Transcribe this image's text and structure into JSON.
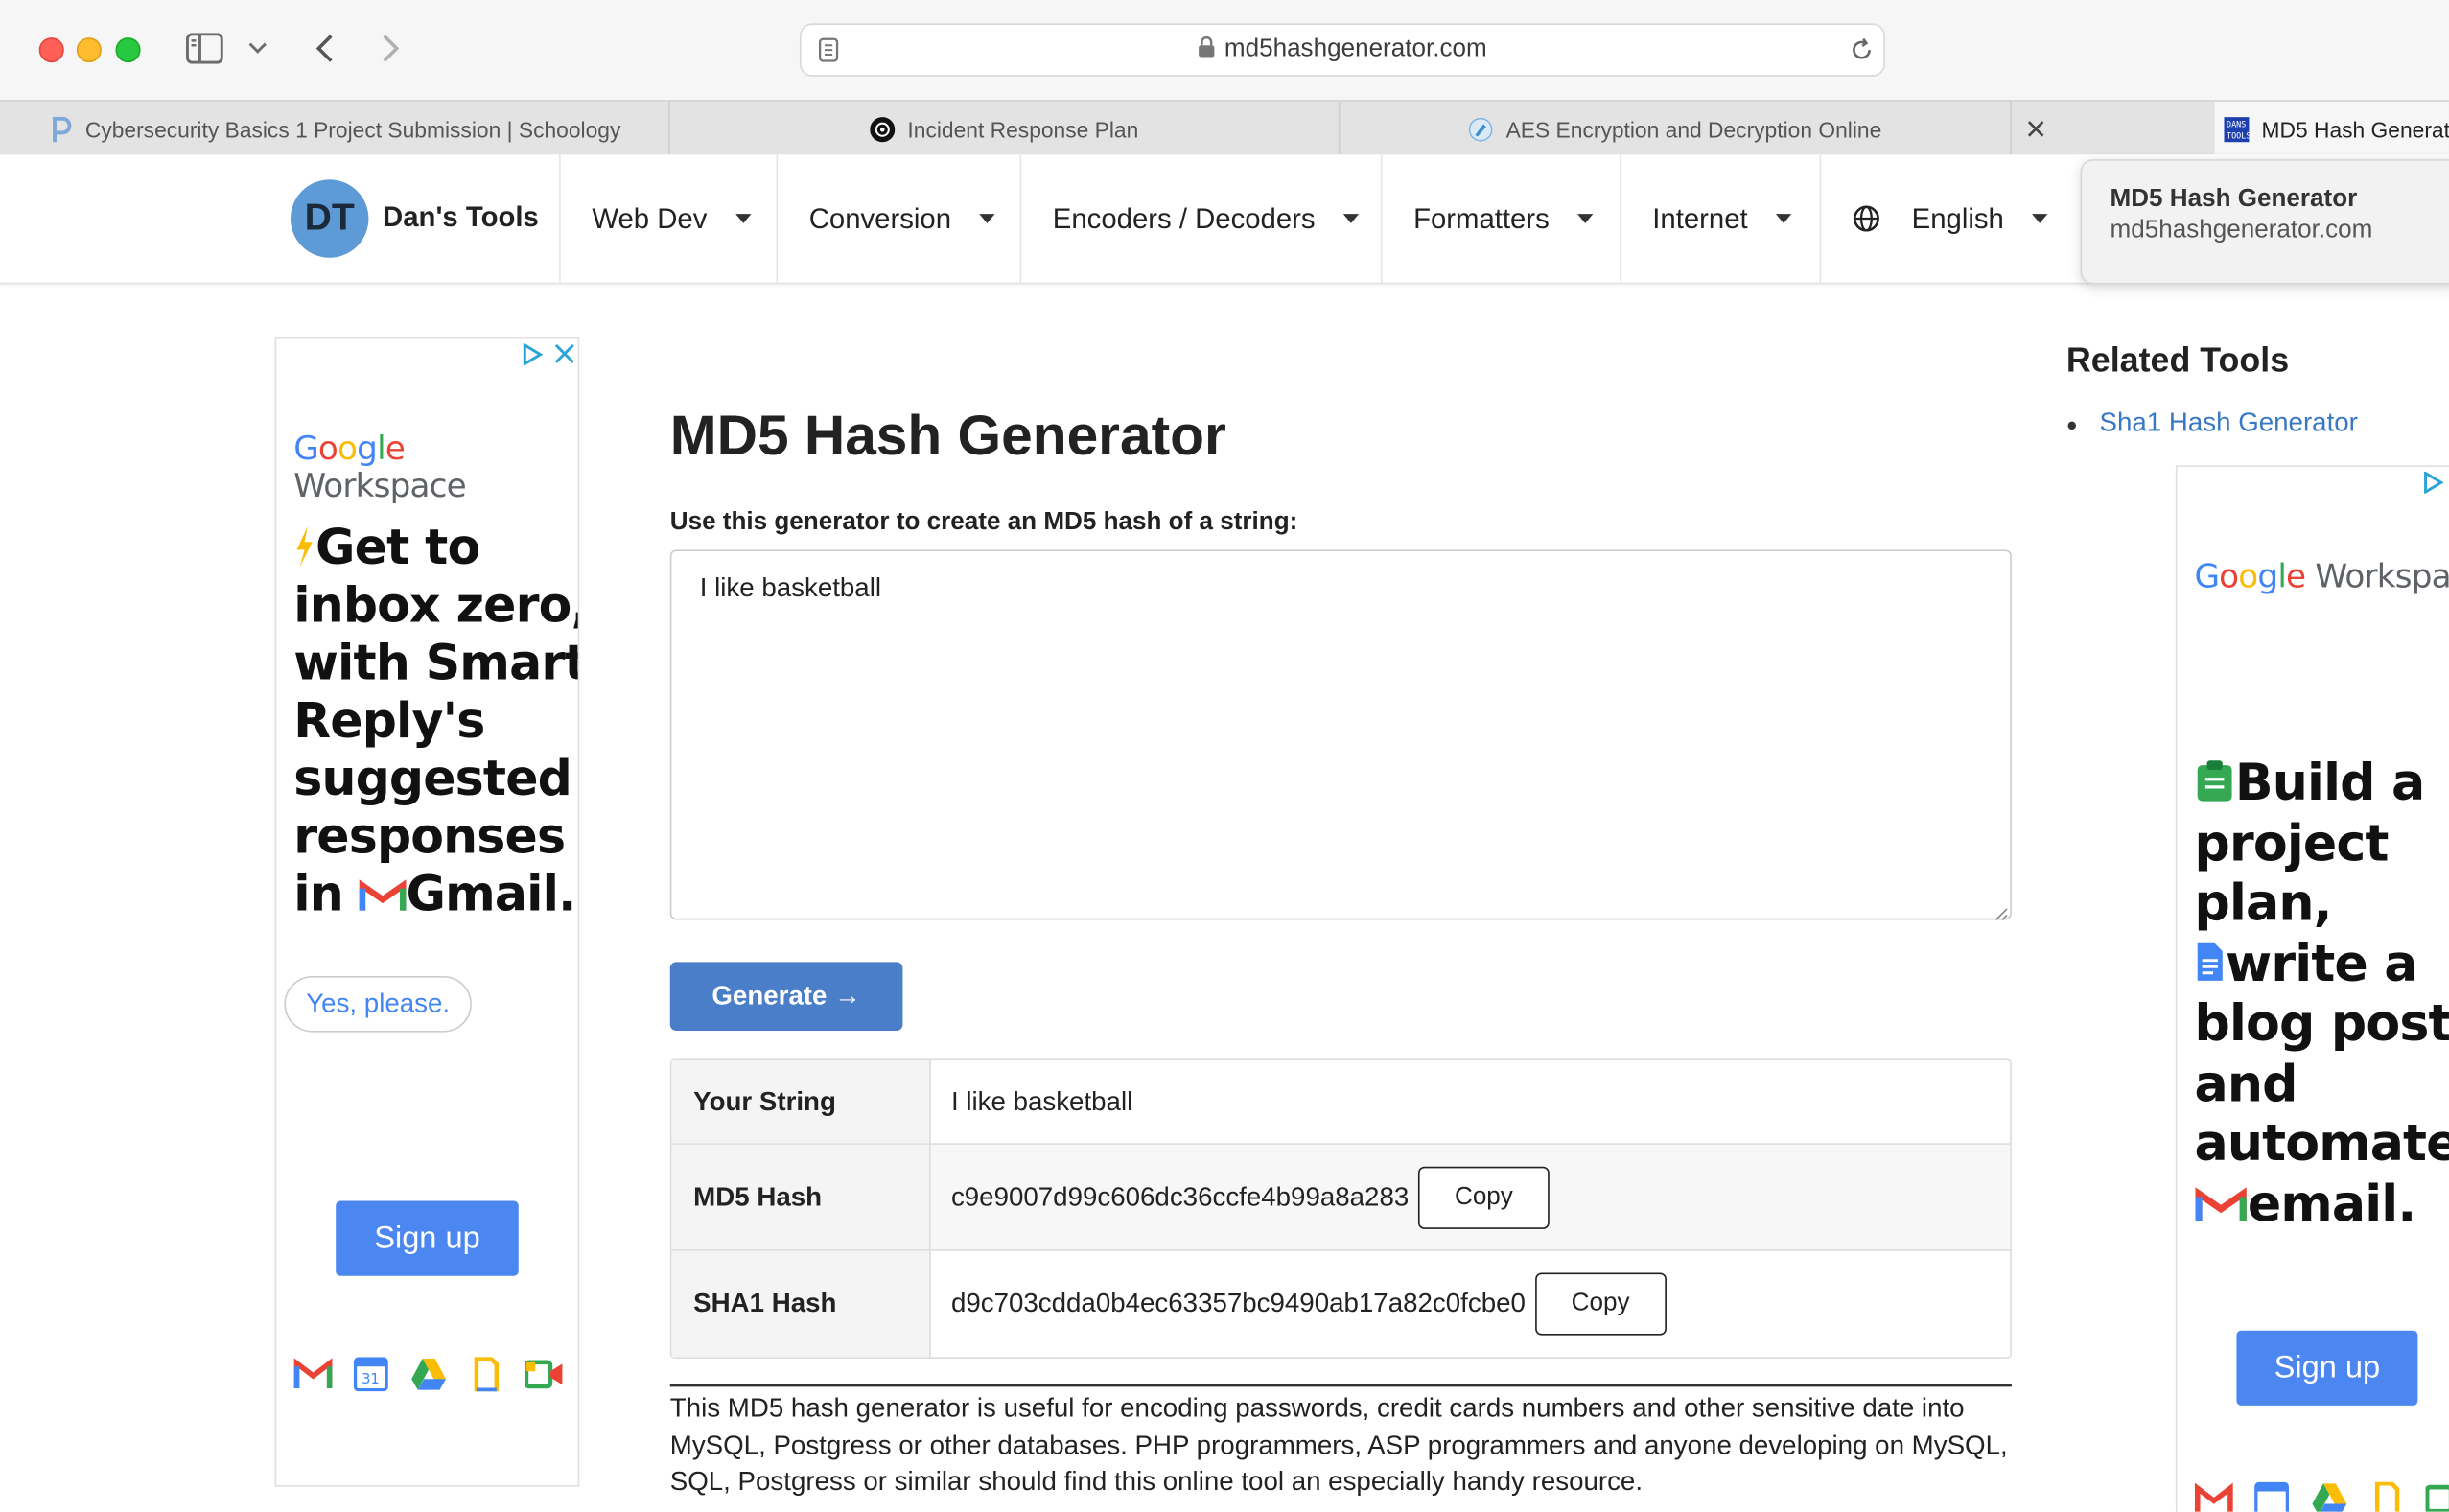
{
  "browser": {
    "url": "md5hashgenerator.com",
    "tabs": [
      {
        "label": "Cybersecurity Basics 1 Project Submission | Schoology"
      },
      {
        "label": "Incident Response Plan"
      },
      {
        "label": "AES Encryption and Decryption Online"
      },
      {
        "label": "MD5 Hash Generat"
      }
    ],
    "tooltip": {
      "title": "MD5 Hash Generator",
      "subtitle": "md5hashgenerator.com"
    }
  },
  "site": {
    "logo_initials": "DT",
    "brand": "Dan's Tools",
    "nav": [
      "Web Dev",
      "Conversion",
      "Encoders / Decoders",
      "Formatters",
      "Internet",
      "English"
    ]
  },
  "ad_left": {
    "brand": "Workspace",
    "headline": [
      "Get to",
      "inbox zero,",
      "with Smart",
      "Reply's",
      "suggested",
      "responses",
      "in",
      "Gmail."
    ],
    "cta_secondary": "Yes, please.",
    "cta_primary": "Sign up"
  },
  "ad_right": {
    "brand": "Workspac",
    "headline": [
      "Build a",
      "project",
      "plan,",
      "write a",
      "blog post,",
      "and",
      "automate",
      "email."
    ],
    "cta_primary": "Sign up"
  },
  "main": {
    "title": "MD5 Hash Generator",
    "input_label": "Use this generator to create an MD5 hash of a string:",
    "input_value": "I like basketball",
    "generate_label": "Generate →",
    "results": [
      {
        "key": "Your String",
        "value": "I like basketball"
      },
      {
        "key": "MD5 Hash",
        "value": "c9e9007d99c606dc36ccfe4b99a8a283",
        "copy": "Copy"
      },
      {
        "key": "SHA1 Hash",
        "value": "d9c703cdda0b4ec63357bc9490ab17a82c0fcbe0",
        "copy": "Copy"
      }
    ],
    "description": "This MD5 hash generator is useful for encoding passwords, credit cards numbers and other sensitive date into MySQL, Postgress or other databases. PHP programmers, ASP programmers and anyone developing on MySQL, SQL, Postgress or similar should find this online tool an especially handy resource."
  },
  "sidebar": {
    "title": "Related Tools",
    "items": [
      "Sha1 Hash Generator"
    ]
  }
}
